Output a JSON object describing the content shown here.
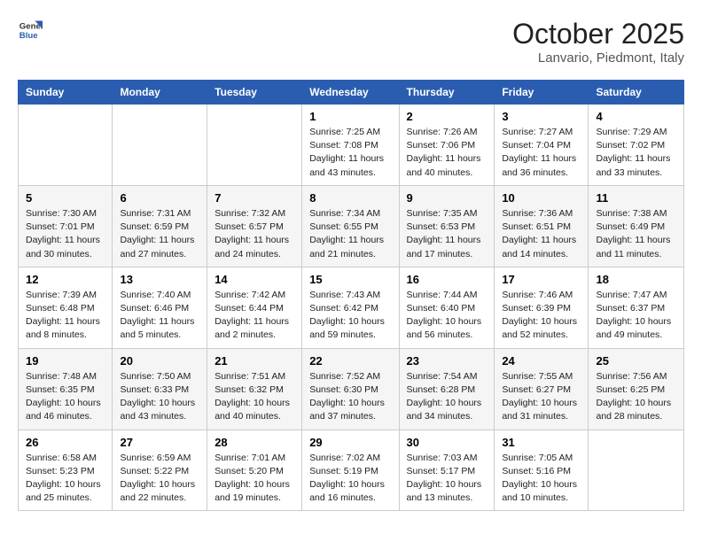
{
  "header": {
    "logo_line1": "General",
    "logo_line2": "Blue",
    "month": "October 2025",
    "location": "Lanvario, Piedmont, Italy"
  },
  "days_of_week": [
    "Sunday",
    "Monday",
    "Tuesday",
    "Wednesday",
    "Thursday",
    "Friday",
    "Saturday"
  ],
  "weeks": [
    [
      {
        "day": "",
        "info": ""
      },
      {
        "day": "",
        "info": ""
      },
      {
        "day": "",
        "info": ""
      },
      {
        "day": "1",
        "info": "Sunrise: 7:25 AM\nSunset: 7:08 PM\nDaylight: 11 hours\nand 43 minutes."
      },
      {
        "day": "2",
        "info": "Sunrise: 7:26 AM\nSunset: 7:06 PM\nDaylight: 11 hours\nand 40 minutes."
      },
      {
        "day": "3",
        "info": "Sunrise: 7:27 AM\nSunset: 7:04 PM\nDaylight: 11 hours\nand 36 minutes."
      },
      {
        "day": "4",
        "info": "Sunrise: 7:29 AM\nSunset: 7:02 PM\nDaylight: 11 hours\nand 33 minutes."
      }
    ],
    [
      {
        "day": "5",
        "info": "Sunrise: 7:30 AM\nSunset: 7:01 PM\nDaylight: 11 hours\nand 30 minutes."
      },
      {
        "day": "6",
        "info": "Sunrise: 7:31 AM\nSunset: 6:59 PM\nDaylight: 11 hours\nand 27 minutes."
      },
      {
        "day": "7",
        "info": "Sunrise: 7:32 AM\nSunset: 6:57 PM\nDaylight: 11 hours\nand 24 minutes."
      },
      {
        "day": "8",
        "info": "Sunrise: 7:34 AM\nSunset: 6:55 PM\nDaylight: 11 hours\nand 21 minutes."
      },
      {
        "day": "9",
        "info": "Sunrise: 7:35 AM\nSunset: 6:53 PM\nDaylight: 11 hours\nand 17 minutes."
      },
      {
        "day": "10",
        "info": "Sunrise: 7:36 AM\nSunset: 6:51 PM\nDaylight: 11 hours\nand 14 minutes."
      },
      {
        "day": "11",
        "info": "Sunrise: 7:38 AM\nSunset: 6:49 PM\nDaylight: 11 hours\nand 11 minutes."
      }
    ],
    [
      {
        "day": "12",
        "info": "Sunrise: 7:39 AM\nSunset: 6:48 PM\nDaylight: 11 hours\nand 8 minutes."
      },
      {
        "day": "13",
        "info": "Sunrise: 7:40 AM\nSunset: 6:46 PM\nDaylight: 11 hours\nand 5 minutes."
      },
      {
        "day": "14",
        "info": "Sunrise: 7:42 AM\nSunset: 6:44 PM\nDaylight: 11 hours\nand 2 minutes."
      },
      {
        "day": "15",
        "info": "Sunrise: 7:43 AM\nSunset: 6:42 PM\nDaylight: 10 hours\nand 59 minutes."
      },
      {
        "day": "16",
        "info": "Sunrise: 7:44 AM\nSunset: 6:40 PM\nDaylight: 10 hours\nand 56 minutes."
      },
      {
        "day": "17",
        "info": "Sunrise: 7:46 AM\nSunset: 6:39 PM\nDaylight: 10 hours\nand 52 minutes."
      },
      {
        "day": "18",
        "info": "Sunrise: 7:47 AM\nSunset: 6:37 PM\nDaylight: 10 hours\nand 49 minutes."
      }
    ],
    [
      {
        "day": "19",
        "info": "Sunrise: 7:48 AM\nSunset: 6:35 PM\nDaylight: 10 hours\nand 46 minutes."
      },
      {
        "day": "20",
        "info": "Sunrise: 7:50 AM\nSunset: 6:33 PM\nDaylight: 10 hours\nand 43 minutes."
      },
      {
        "day": "21",
        "info": "Sunrise: 7:51 AM\nSunset: 6:32 PM\nDaylight: 10 hours\nand 40 minutes."
      },
      {
        "day": "22",
        "info": "Sunrise: 7:52 AM\nSunset: 6:30 PM\nDaylight: 10 hours\nand 37 minutes."
      },
      {
        "day": "23",
        "info": "Sunrise: 7:54 AM\nSunset: 6:28 PM\nDaylight: 10 hours\nand 34 minutes."
      },
      {
        "day": "24",
        "info": "Sunrise: 7:55 AM\nSunset: 6:27 PM\nDaylight: 10 hours\nand 31 minutes."
      },
      {
        "day": "25",
        "info": "Sunrise: 7:56 AM\nSunset: 6:25 PM\nDaylight: 10 hours\nand 28 minutes."
      }
    ],
    [
      {
        "day": "26",
        "info": "Sunrise: 6:58 AM\nSunset: 5:23 PM\nDaylight: 10 hours\nand 25 minutes."
      },
      {
        "day": "27",
        "info": "Sunrise: 6:59 AM\nSunset: 5:22 PM\nDaylight: 10 hours\nand 22 minutes."
      },
      {
        "day": "28",
        "info": "Sunrise: 7:01 AM\nSunset: 5:20 PM\nDaylight: 10 hours\nand 19 minutes."
      },
      {
        "day": "29",
        "info": "Sunrise: 7:02 AM\nSunset: 5:19 PM\nDaylight: 10 hours\nand 16 minutes."
      },
      {
        "day": "30",
        "info": "Sunrise: 7:03 AM\nSunset: 5:17 PM\nDaylight: 10 hours\nand 13 minutes."
      },
      {
        "day": "31",
        "info": "Sunrise: 7:05 AM\nSunset: 5:16 PM\nDaylight: 10 hours\nand 10 minutes."
      },
      {
        "day": "",
        "info": ""
      }
    ]
  ]
}
